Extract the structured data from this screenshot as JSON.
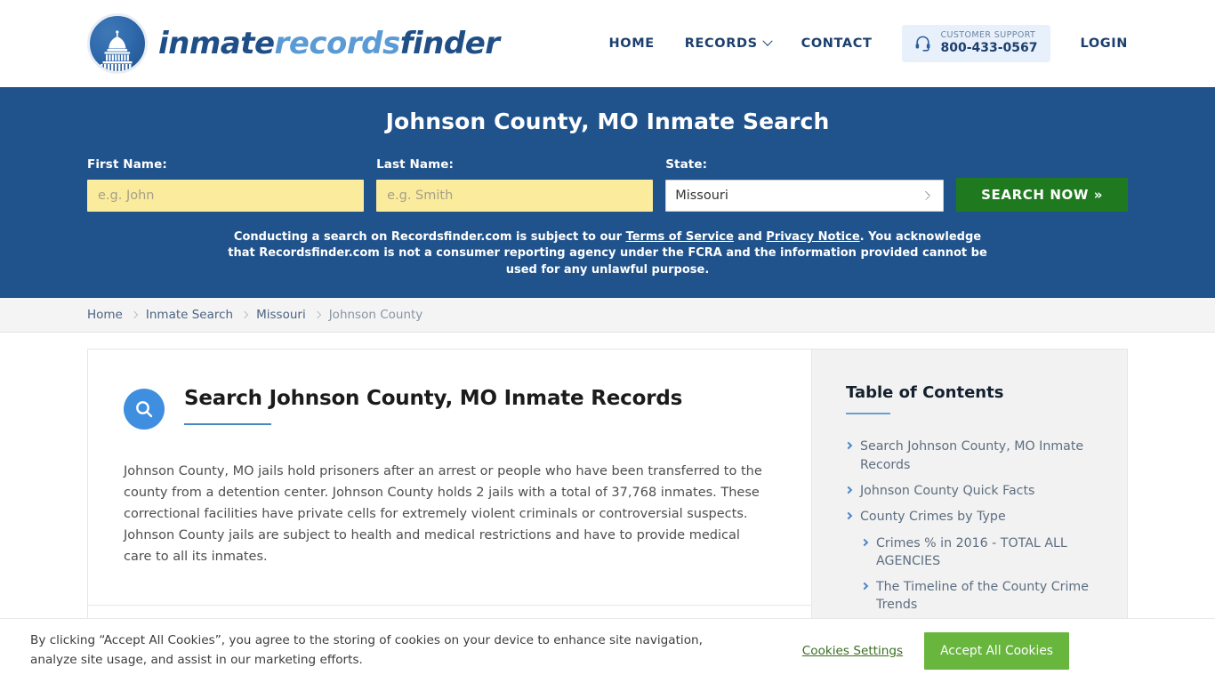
{
  "brand": {
    "logo_icon": "capitol-dome-icon",
    "word_a": "inmate",
    "word_b": "records",
    "word_c": "finder"
  },
  "nav": {
    "home": "HOME",
    "records": "RECORDS",
    "contact": "CONTACT",
    "login": "LOGIN",
    "support_label": "CUSTOMER SUPPORT",
    "support_phone": "800-433-0567",
    "support_icon": "headset-icon",
    "records_caret_icon": "chevron-down-icon"
  },
  "hero": {
    "title": "Johnson County, MO Inmate Search",
    "first_name_label": "First Name:",
    "first_name_placeholder": "e.g. John",
    "first_name_value": "",
    "last_name_label": "Last Name:",
    "last_name_placeholder": "e.g. Smith",
    "last_name_value": "",
    "state_label": "State:",
    "state_value": "Missouri",
    "state_options": [
      "Missouri"
    ],
    "search_button": "SEARCH NOW »",
    "disclaimer_pre": "Conducting a search on Recordsfinder.com is subject to our ",
    "disclaimer_link1": "Terms of Service",
    "disclaimer_mid": " and ",
    "disclaimer_link2": "Privacy Notice",
    "disclaimer_post": ". You acknowledge that Recordsfinder.com is not a consumer reporting agency under the FCRA and the information provided cannot be used for any unlawful purpose."
  },
  "breadcrumb": {
    "items": [
      {
        "label": "Home"
      },
      {
        "label": "Inmate Search"
      },
      {
        "label": "Missouri"
      },
      {
        "label": "Johnson County"
      }
    ]
  },
  "article": {
    "icon": "search-circle-icon",
    "title": "Search Johnson County, MO Inmate Records",
    "body": "Johnson County, MO jails hold prisoners after an arrest or people who have been transferred to the county from a detention center. Johnson County holds 2 jails with a total of 37,768 inmates. These correctional facilities have private cells for extremely violent criminals or controversial suspects. Johnson County jails are subject to health and medical restrictions and have to provide medical care to all its inmates."
  },
  "toc": {
    "title": "Table of Contents",
    "items": [
      {
        "label": "Search Johnson County, MO Inmate Records",
        "level": 1
      },
      {
        "label": "Johnson County Quick Facts",
        "level": 1
      },
      {
        "label": "County Crimes by Type",
        "level": 1
      },
      {
        "label": "Crimes % in 2016 - TOTAL ALL AGENCIES",
        "level": 2
      },
      {
        "label": "The Timeline of the County Crime Trends",
        "level": 2
      }
    ]
  },
  "cookies": {
    "text": "By clicking “Accept All Cookies”, you agree to the storing of cookies on your device to enhance site navigation, analyze site usage, and assist in our marketing efforts.",
    "settings_label": "Cookies Settings",
    "accept_label": "Accept All Cookies"
  },
  "colors": {
    "hero_blue": "#20538c",
    "nav_navy": "#1c3f6e",
    "input_yellow": "#fbeb9c",
    "search_green": "#1f7a1f",
    "cookie_green": "#68b63e",
    "accent_blue": "#3f8ee0"
  }
}
